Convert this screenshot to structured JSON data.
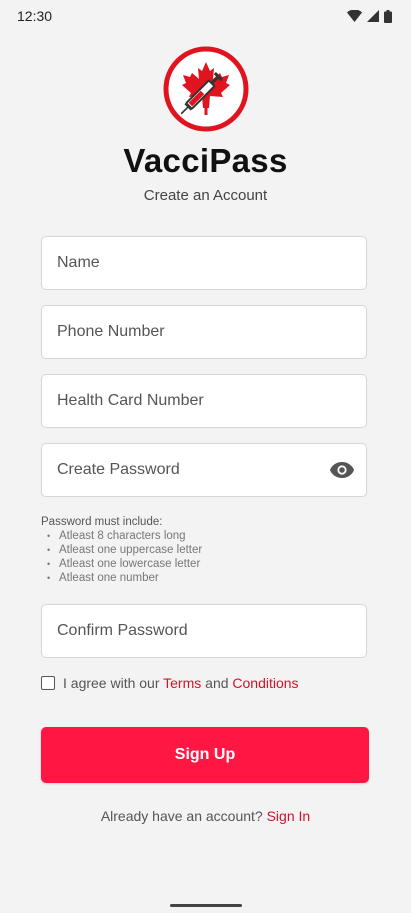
{
  "status_bar": {
    "time": "12:30",
    "icons": [
      "wifi-icon",
      "signal-icon",
      "battery-icon"
    ]
  },
  "app": {
    "name": "VacciPass",
    "subtitle": "Create an Account",
    "logo_icon": "maple-leaf-syringe-logo"
  },
  "form": {
    "name_placeholder": "Name",
    "phone_placeholder": "Phone Number",
    "health_card_placeholder": "Health Card Number",
    "password_placeholder": "Create Password",
    "confirm_placeholder": "Confirm Password",
    "password_rules": {
      "title": "Password must include:",
      "items": [
        "Atleast 8 characters long",
        "Atleast one uppercase letter",
        "Atleast one lowercase letter",
        "Atleast one number"
      ]
    },
    "agree": {
      "prefix": "I agree with our",
      "terms": "Terms",
      "and": "and",
      "conditions": "Conditions"
    },
    "signup_label": "Sign Up",
    "signin_prompt": "Already have an account?",
    "signin_label": "Sign In"
  },
  "colors": {
    "accent": "#ff1744",
    "link": "#d4122a",
    "background": "#f3f3f3"
  }
}
